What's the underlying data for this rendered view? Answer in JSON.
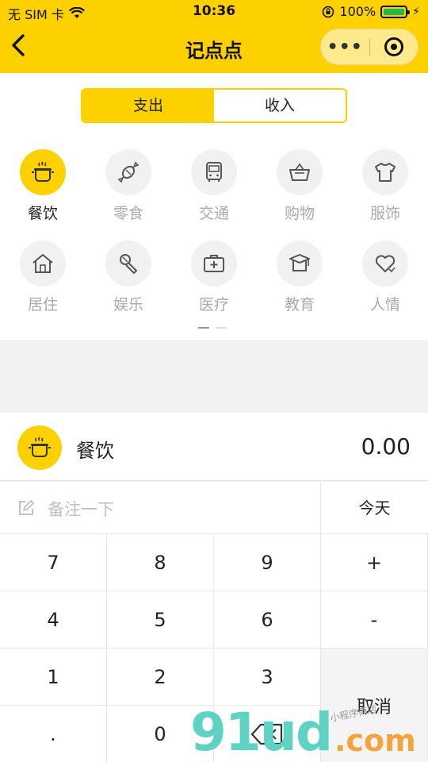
{
  "status_bar": {
    "carrier": "无 SIM 卡",
    "time": "10:36",
    "battery_percent": "100%"
  },
  "header": {
    "back_icon": "chevron-left",
    "title": "记点点",
    "more_label": "•••"
  },
  "toggle": {
    "expense": "支出",
    "income": "收入",
    "selected": "expense"
  },
  "categories": [
    {
      "label": "餐饮",
      "icon": "pot-icon",
      "active": true
    },
    {
      "label": "零食",
      "icon": "candy-icon",
      "active": false
    },
    {
      "label": "交通",
      "icon": "bus-icon",
      "active": false
    },
    {
      "label": "购物",
      "icon": "basket-icon",
      "active": false
    },
    {
      "label": "服饰",
      "icon": "shirt-icon",
      "active": false
    },
    {
      "label": "居住",
      "icon": "house-icon",
      "active": false
    },
    {
      "label": "娱乐",
      "icon": "microphone-icon",
      "active": false
    },
    {
      "label": "医疗",
      "icon": "medkit-icon",
      "active": false
    },
    {
      "label": "教育",
      "icon": "graduation-cap-icon",
      "active": false
    },
    {
      "label": "人情",
      "icon": "heart-icon",
      "active": false
    }
  ],
  "entry": {
    "category": "餐饮",
    "amount": "0.00",
    "note_placeholder": "备注一下",
    "date": "今天"
  },
  "keypad": {
    "k7": "7",
    "k8": "8",
    "k9": "9",
    "plus": "+",
    "k4": "4",
    "k5": "5",
    "k6": "6",
    "minus": "-",
    "k1": "1",
    "k2": "2",
    "k3": "3",
    "dot": ".",
    "k0": "0",
    "cancel": "取消"
  },
  "watermark": {
    "main": "91ud",
    "domain": ".com",
    "small": "小程序商店"
  },
  "colors": {
    "accent": "#fdd000",
    "inactive_text": "#aaaaaa"
  }
}
